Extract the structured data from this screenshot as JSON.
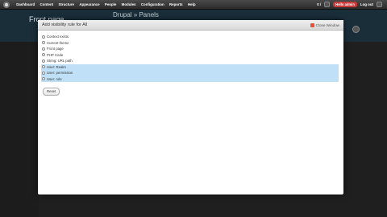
{
  "toolbar": {
    "menu": [
      "Dashboard",
      "Content",
      "Structure",
      "Appearance",
      "People",
      "Modules",
      "Configuration",
      "Reports",
      "Help"
    ],
    "shortcut": "0 /",
    "hello": "Hello admin",
    "logout": "Log out"
  },
  "background": {
    "page_title": "Front page",
    "subtitle": "Drupal » Panels"
  },
  "modal": {
    "title": "Add visibility rule for All",
    "close_label": "Close Window",
    "options": [
      {
        "label": "Context exists"
      },
      {
        "label": "Current theme"
      },
      {
        "label": "Front page"
      },
      {
        "label": "PHP Code"
      },
      {
        "label": "String: URL path"
      },
      {
        "label": "User: Realm"
      },
      {
        "label": "User: permission"
      },
      {
        "label": "User: role"
      }
    ],
    "reset_label": "Reset"
  }
}
